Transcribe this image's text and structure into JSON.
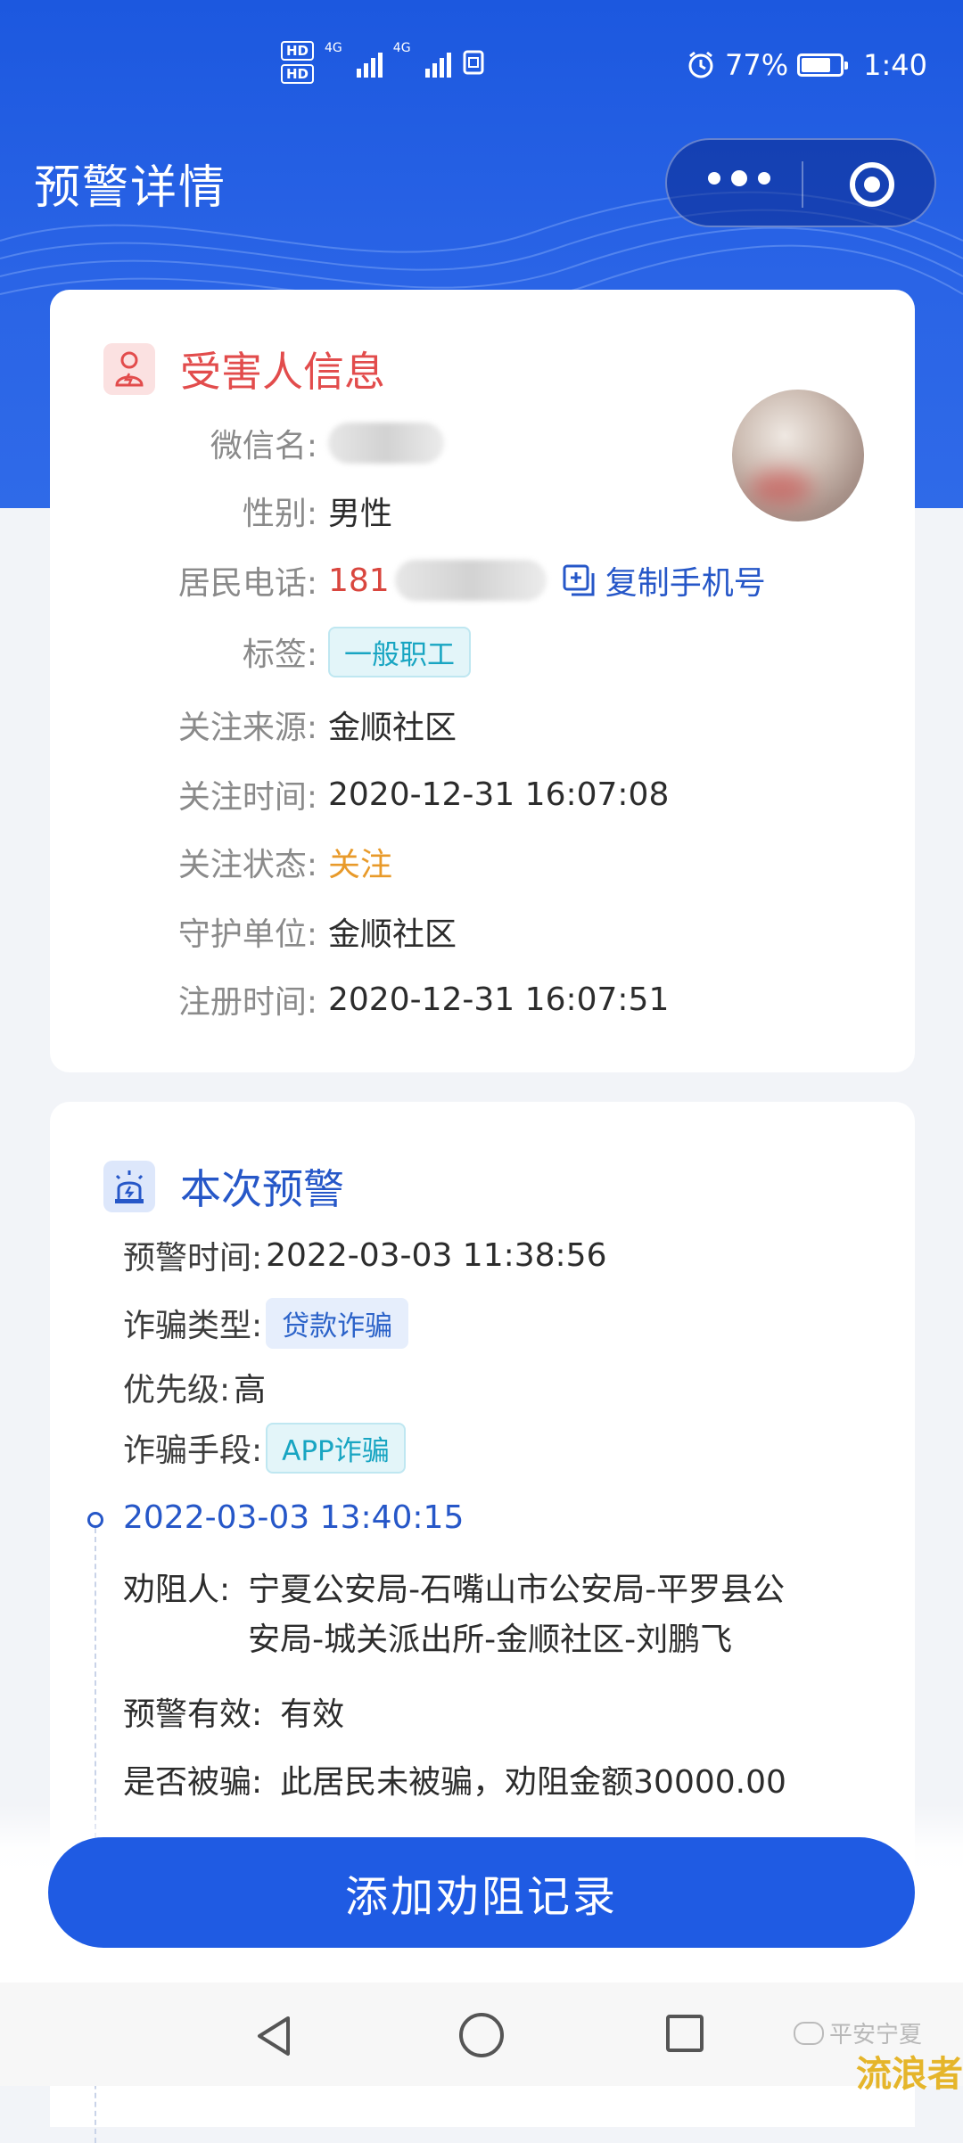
{
  "status_bar": {
    "hd1": "HD",
    "hd2": "HD",
    "net1": "4G",
    "net2": "4G",
    "battery_text": "77%",
    "battery_level": 0.77,
    "time": "1:40"
  },
  "header": {
    "title": "预警详情"
  },
  "victim": {
    "section_title": "受害人信息",
    "labels": {
      "wechat": "微信名:",
      "gender": "性别:",
      "phone": "居民电话:",
      "tag": "标签:",
      "source": "关注来源:",
      "follow_time": "关注时间:",
      "follow_status": "关注状态:",
      "guard_unit": "守护单位:",
      "register_time": "注册时间:"
    },
    "gender": "男性",
    "phone_prefix": "181",
    "copy_label": "复制手机号",
    "tag": "一般职工",
    "source": "金顺社区",
    "follow_time": "2020-12-31 16:07:08",
    "follow_status": "关注",
    "guard_unit": "金顺社区",
    "register_time": "2020-12-31 16:07:51"
  },
  "alert": {
    "section_title": "本次预警",
    "labels": {
      "alert_time": "预警时间:",
      "fraud_type": "诈骗类型:",
      "priority": "优先级:",
      "method": "诈骗手段:"
    },
    "alert_time": "2022-03-03 11:38:56",
    "fraud_type": "贷款诈骗",
    "priority": "高",
    "method": "APP诈骗"
  },
  "timeline": {
    "time": "2022-03-03 13:40:15",
    "labels": {
      "persuader": "劝阻人:",
      "valid": "预警有效:",
      "deceived": "是否被骗:"
    },
    "persuader_line1": "宁夏公安局-石嘴山市公安局-平罗县公",
    "persuader_line2": "安局-城关派出所-金顺社区-刘鹏飞",
    "valid": "有效",
    "deceived": "此居民未被骗，劝阻金额30000.00"
  },
  "footer": {
    "add_button": "添加劝阻记录"
  },
  "watermark": {
    "text1": "平安宁夏",
    "text2": "流浪者"
  },
  "colors": {
    "brand_blue": "#1f5be3",
    "victim_red": "#e24c4c",
    "status_orange": "#e89a2a"
  },
  "icons": {
    "victim": "user-shield-icon",
    "alert": "siren-icon",
    "copy": "copy-icon"
  }
}
